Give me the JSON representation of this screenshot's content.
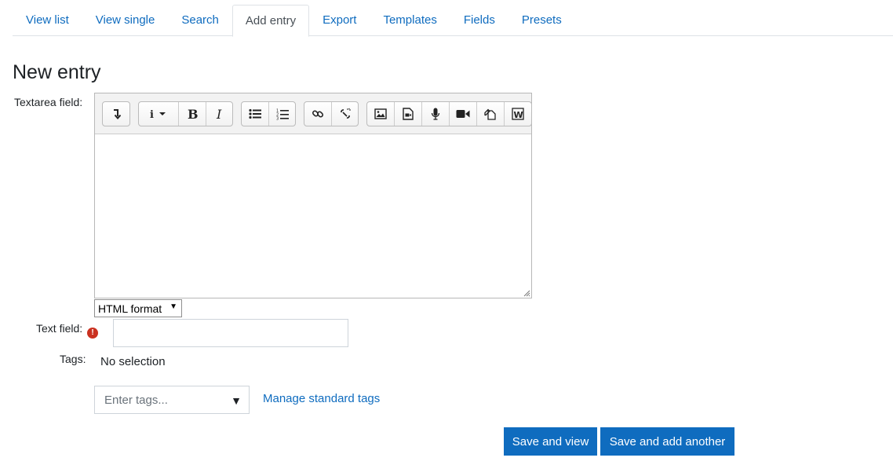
{
  "tabs": [
    {
      "label": "View list",
      "active": false
    },
    {
      "label": "View single",
      "active": false
    },
    {
      "label": "Search",
      "active": false
    },
    {
      "label": "Add entry",
      "active": true
    },
    {
      "label": "Export",
      "active": false
    },
    {
      "label": "Templates",
      "active": false
    },
    {
      "label": "Fields",
      "active": false
    },
    {
      "label": "Presets",
      "active": false
    }
  ],
  "page": {
    "title": "New entry"
  },
  "form": {
    "textarea_label": "Textarea field:",
    "editor_toolbar": [
      "collapse-icon",
      "info-style-icon",
      "bold-icon",
      "italic-icon",
      "unordered-list-icon",
      "ordered-list-icon",
      "link-icon",
      "unlink-icon",
      "image-icon",
      "media-icon",
      "record-audio-icon",
      "record-video-icon",
      "manage-files-icon",
      "paste-word-icon"
    ],
    "format_value": "HTML format",
    "text_field_label": "Text field:",
    "text_field_value": "",
    "tags_label": "Tags:",
    "tags_selection": "No selection",
    "tags_placeholder": "Enter tags...",
    "manage_tags_link": "Manage standard tags"
  },
  "buttons": {
    "save_view": "Save and view",
    "save_add": "Save and add another"
  },
  "colors": {
    "link": "#0f6cbf",
    "primary": "#0f6cbf",
    "required": "#ca3120"
  }
}
